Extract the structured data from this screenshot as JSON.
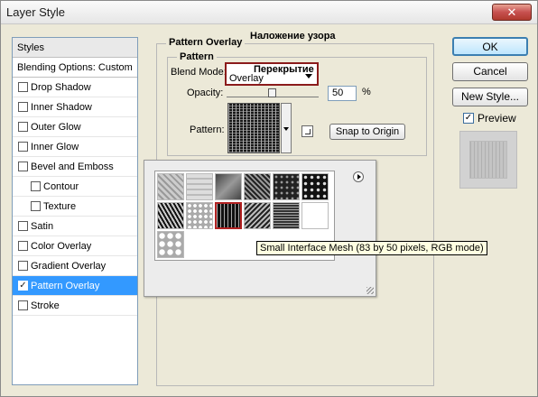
{
  "window": {
    "title": "Layer Style",
    "close_symbol": "✕"
  },
  "styles_panel": {
    "header": "Styles",
    "blending_options": "Blending Options: Custom",
    "items": [
      {
        "label": "Drop Shadow",
        "checked": false,
        "sub": false
      },
      {
        "label": "Inner Shadow",
        "checked": false,
        "sub": false
      },
      {
        "label": "Outer Glow",
        "checked": false,
        "sub": false
      },
      {
        "label": "Inner Glow",
        "checked": false,
        "sub": false
      },
      {
        "label": "Bevel and Emboss",
        "checked": false,
        "sub": false
      },
      {
        "label": "Contour",
        "checked": false,
        "sub": true
      },
      {
        "label": "Texture",
        "checked": false,
        "sub": true
      },
      {
        "label": "Satin",
        "checked": false,
        "sub": false
      },
      {
        "label": "Color Overlay",
        "checked": false,
        "sub": false
      },
      {
        "label": "Gradient Overlay",
        "checked": false,
        "sub": false
      },
      {
        "label": "Pattern Overlay",
        "checked": true,
        "sub": false,
        "selected": true
      },
      {
        "label": "Stroke",
        "checked": false,
        "sub": false
      }
    ]
  },
  "pattern_overlay": {
    "group_title": "Pattern Overlay",
    "annotation_title": "Наложение узора",
    "inner_title": "Pattern",
    "blend_mode_label": "Blend Mode:",
    "blend_mode_value": "Overlay",
    "blend_mode_annotation": "Перекрытие",
    "opacity_label": "Opacity:",
    "opacity_value": "50",
    "opacity_unit": "%",
    "opacity_level": 0.5,
    "pattern_label": "Pattern:",
    "snap_button": "Snap to Origin"
  },
  "buttons": {
    "ok": "OK",
    "cancel": "Cancel",
    "new_style": "New Style...",
    "preview_label": "Preview",
    "preview_checked": true,
    "check_symbol": "✓"
  },
  "picker": {
    "selected_index": 8,
    "tooltip": "Small Interface Mesh (83 by 50 pixels, RGB mode)"
  }
}
